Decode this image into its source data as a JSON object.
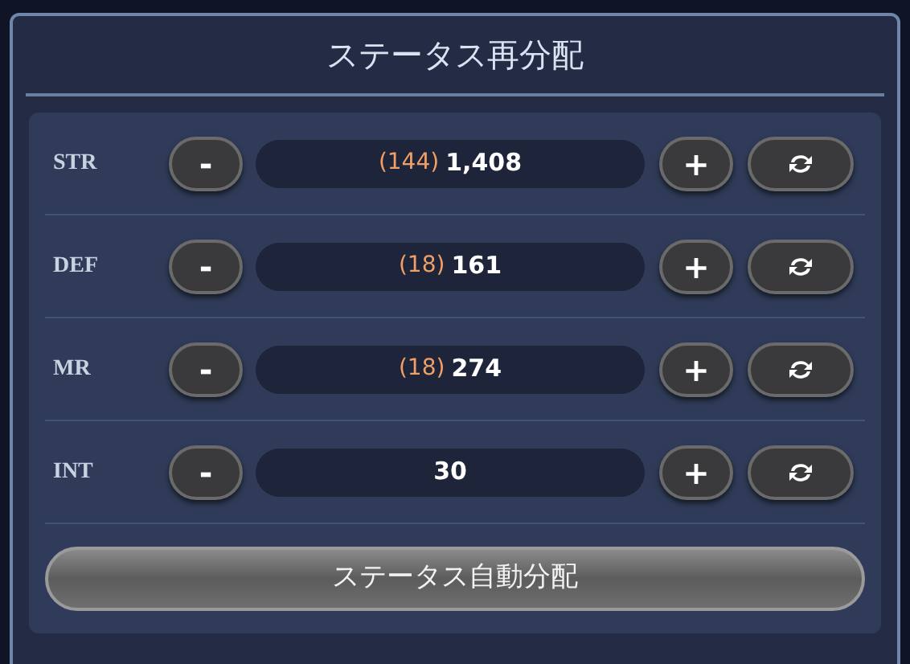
{
  "title": "ステータス再分配",
  "stats": [
    {
      "name": "STR",
      "minus": "-",
      "bonus": "(144)",
      "value": "1,408",
      "plus": "+"
    },
    {
      "name": "DEF",
      "minus": "-",
      "bonus": "(18)",
      "value": "161",
      "plus": "+"
    },
    {
      "name": "MR",
      "minus": "-",
      "bonus": "(18)",
      "value": "274",
      "plus": "+"
    },
    {
      "name": "INT",
      "minus": "-",
      "value": "30",
      "plus": "+"
    }
  ],
  "auto_button": "ステータス自動分配"
}
